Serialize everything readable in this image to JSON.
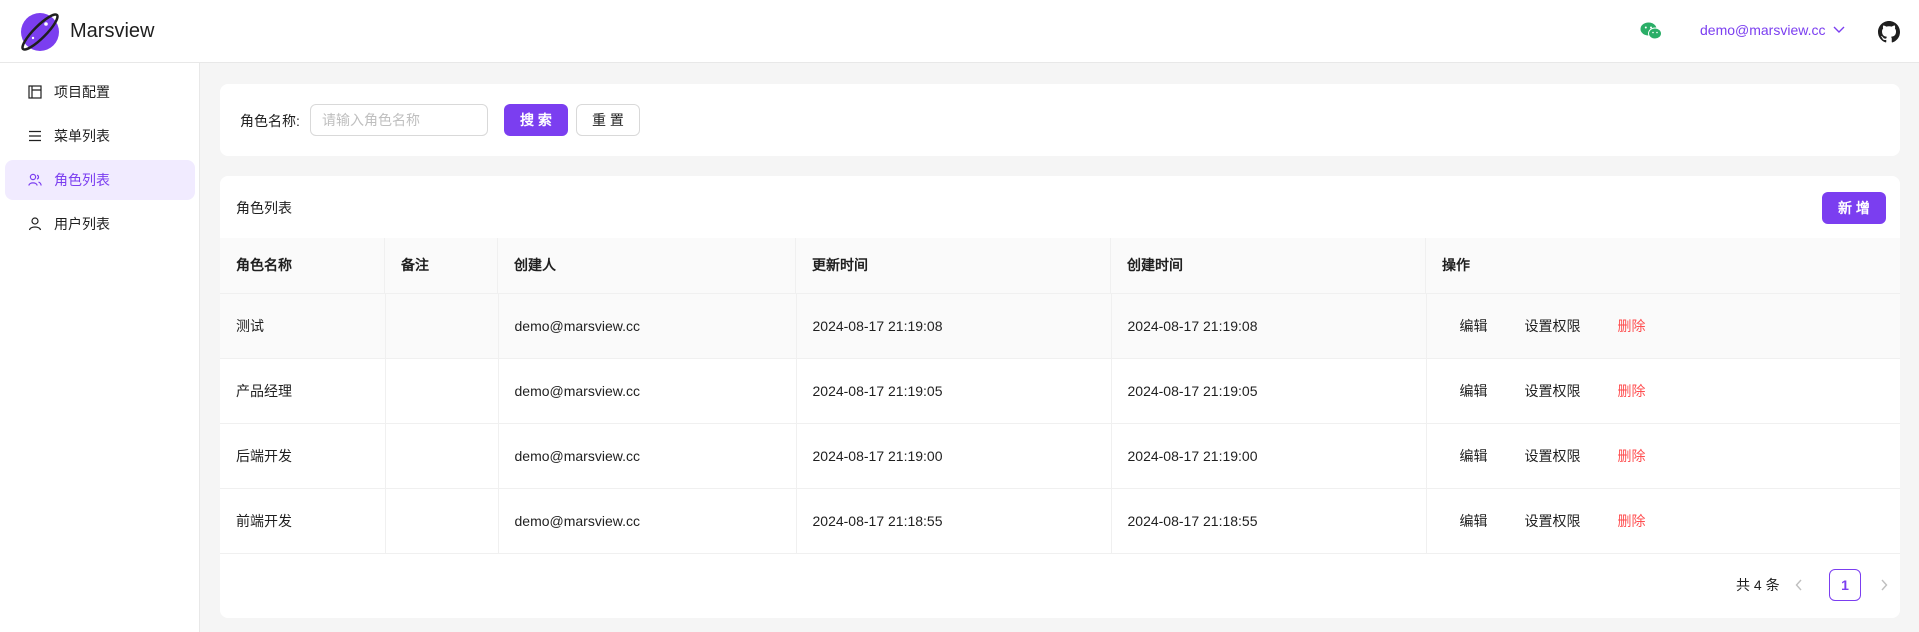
{
  "app": {
    "title": "Marsview",
    "user_email": "demo@marsview.cc"
  },
  "colors": {
    "accent": "#7b3ef0",
    "danger": "#ff4d4f",
    "wechat": "#2aae67"
  },
  "sidebar": {
    "items": [
      {
        "label": "项目配置",
        "icon": "layout-icon",
        "active": false
      },
      {
        "label": "菜单列表",
        "icon": "menu-icon",
        "active": false
      },
      {
        "label": "角色列表",
        "icon": "role-icon",
        "active": true
      },
      {
        "label": "用户列表",
        "icon": "user-icon",
        "active": false
      }
    ]
  },
  "search": {
    "label": "角色名称:",
    "placeholder": "请输入角色名称",
    "value": "",
    "search_label": "搜 索",
    "reset_label": "重 置"
  },
  "table": {
    "title": "角色列表",
    "add_label": "新 增",
    "columns": [
      "角色名称",
      "备注",
      "创建人",
      "更新时间",
      "创建时间",
      "操作"
    ],
    "rows": [
      {
        "name": "测试",
        "remark": "",
        "creator": "demo@marsview.cc",
        "updated": "2024-08-17 21:19:08",
        "created": "2024-08-17 21:19:08"
      },
      {
        "name": "产品经理",
        "remark": "",
        "creator": "demo@marsview.cc",
        "updated": "2024-08-17 21:19:05",
        "created": "2024-08-17 21:19:05"
      },
      {
        "name": "后端开发",
        "remark": "",
        "creator": "demo@marsview.cc",
        "updated": "2024-08-17 21:19:00",
        "created": "2024-08-17 21:19:00"
      },
      {
        "name": "前端开发",
        "remark": "",
        "creator": "demo@marsview.cc",
        "updated": "2024-08-17 21:18:55",
        "created": "2024-08-17 21:18:55"
      }
    ],
    "actions": {
      "edit": "编辑",
      "permission": "设置权限",
      "delete": "删除"
    }
  },
  "pagination": {
    "total_text": "共 4 条",
    "current_page": "1"
  }
}
